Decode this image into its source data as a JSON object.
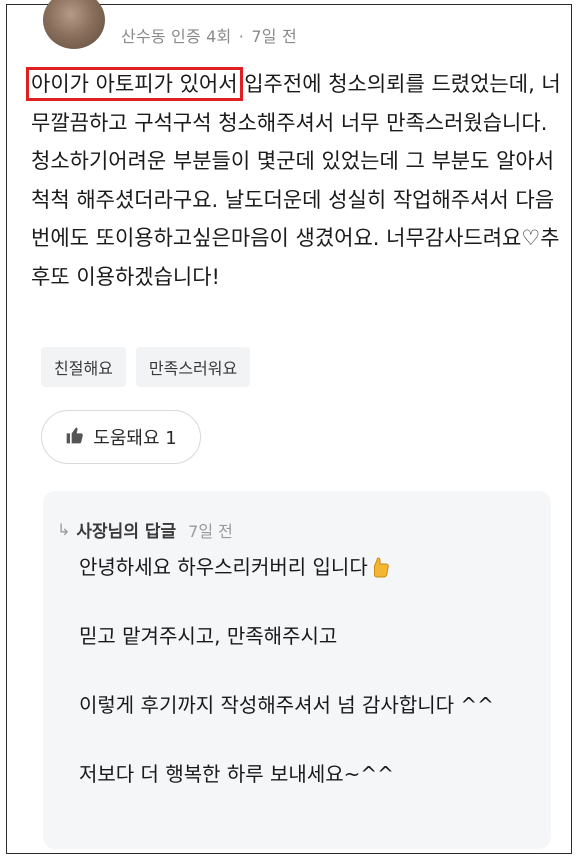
{
  "review": {
    "author_meta": "산수동 인증 4회",
    "time": "7일 전",
    "highlight": "아이가 아토피가 있어서",
    "text_rest": " 입주전에 청소의뢰를 드렸었는데, 너무깔끔하고 구석구석 청소해주셔서 너무 만족스러웠습니다. 청소하기어려운 부분들이 몇군데 있었는데 그 부분도 알아서척척 해주셨더라구요. 날도더운데 성실히 작업해주셔서 다음번에도 또이용하고싶은마음이 생겼어요. 너무감사드려요♡추후또 이용하겠습니다!",
    "tags": [
      "친절해요",
      "만족스러워요"
    ],
    "helpful_label": "도움돼요 1"
  },
  "reply": {
    "title": "사장님의 답글",
    "time": "7일 전",
    "lines": [
      "안녕하세요 하우스리커버리 입니다",
      "믿고 맡겨주시고, 만족해주시고",
      "이렇게 후기까지 작성해주셔서 넘 감사합니다 ^^",
      "저보다 더 행복한 하루 보내세요~^^"
    ]
  },
  "icons": {
    "helpful": "thumbs-up-icon",
    "reply_arrow": "reply-arrow-icon",
    "emoji": "thumbs-up-emoji"
  },
  "colors": {
    "highlight_border": "#e02020",
    "reply_bg": "#f5f6f8",
    "tag_bg": "#f2f3f5",
    "meta_text": "#8a8a8a"
  }
}
